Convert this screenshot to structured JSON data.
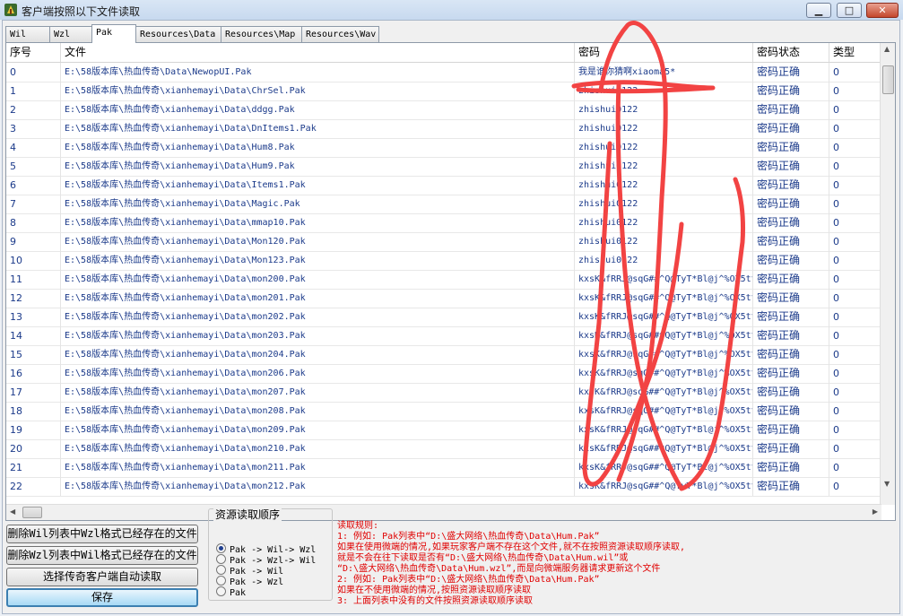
{
  "window": {
    "title": "客户端按照以下文件读取",
    "minimize": "▁",
    "maximize": "□",
    "close": "✕"
  },
  "tabs": [
    {
      "label": "Wil"
    },
    {
      "label": "Wzl"
    },
    {
      "label": "Pak"
    },
    {
      "label": "Resources\\Data"
    },
    {
      "label": "Resources\\Map"
    },
    {
      "label": "Resources\\Wav"
    }
  ],
  "columns": [
    "序号",
    "文件",
    "密码",
    "密码状态",
    "类型"
  ],
  "rows": [
    {
      "idx": "0",
      "file": "E:\\58版本库\\热血传奇\\Data\\NewopUI.Pak",
      "pw": "我是谁你猜啊xiaoma5*",
      "status": "密码正确",
      "type": "0"
    },
    {
      "idx": "1",
      "file": "E:\\58版本库\\热血传奇\\xianhemayi\\Data\\ChrSel.Pak",
      "pw": "zhishui0122",
      "status": "密码正确",
      "type": "0"
    },
    {
      "idx": "2",
      "file": "E:\\58版本库\\热血传奇\\xianhemayi\\Data\\ddgg.Pak",
      "pw": "zhishui0122",
      "status": "密码正确",
      "type": "0"
    },
    {
      "idx": "3",
      "file": "E:\\58版本库\\热血传奇\\xianhemayi\\Data\\DnItems1.Pak",
      "pw": "zhishui0122",
      "status": "密码正确",
      "type": "0"
    },
    {
      "idx": "4",
      "file": "E:\\58版本库\\热血传奇\\xianhemayi\\Data\\Hum8.Pak",
      "pw": "zhishui0122",
      "status": "密码正确",
      "type": "0"
    },
    {
      "idx": "5",
      "file": "E:\\58版本库\\热血传奇\\xianhemayi\\Data\\Hum9.Pak",
      "pw": "zhishui0122",
      "status": "密码正确",
      "type": "0"
    },
    {
      "idx": "6",
      "file": "E:\\58版本库\\热血传奇\\xianhemayi\\Data\\Items1.Pak",
      "pw": "zhishui0122",
      "status": "密码正确",
      "type": "0"
    },
    {
      "idx": "7",
      "file": "E:\\58版本库\\热血传奇\\xianhemayi\\Data\\Magic.Pak",
      "pw": "zhishui0122",
      "status": "密码正确",
      "type": "0"
    },
    {
      "idx": "8",
      "file": "E:\\58版本库\\热血传奇\\xianhemayi\\Data\\mmap10.Pak",
      "pw": "zhishui0122",
      "status": "密码正确",
      "type": "0"
    },
    {
      "idx": "9",
      "file": "E:\\58版本库\\热血传奇\\xianhemayi\\Data\\Mon120.Pak",
      "pw": "zhishui0122",
      "status": "密码正确",
      "type": "0"
    },
    {
      "idx": "10",
      "file": "E:\\58版本库\\热血传奇\\xianhemayi\\Data\\Mon123.Pak",
      "pw": "zhishui0122",
      "status": "密码正确",
      "type": "0"
    },
    {
      "idx": "11",
      "file": "E:\\58版本库\\热血传奇\\xianhemayi\\Data\\mon200.Pak",
      "pw": "kxsK&fRRJ@sqG##^Q@TyT*Bl@j^%OX5tt",
      "status": "密码正确",
      "type": "0"
    },
    {
      "idx": "12",
      "file": "E:\\58版本库\\热血传奇\\xianhemayi\\Data\\mon201.Pak",
      "pw": "kxsK&fRRJ@sqG##^Q@TyT*Bl@j^%OX5tt",
      "status": "密码正确",
      "type": "0"
    },
    {
      "idx": "13",
      "file": "E:\\58版本库\\热血传奇\\xianhemayi\\Data\\mon202.Pak",
      "pw": "kxsK&fRRJ@sqG##^Q@TyT*Bl@j^%OX5tt",
      "status": "密码正确",
      "type": "0"
    },
    {
      "idx": "14",
      "file": "E:\\58版本库\\热血传奇\\xianhemayi\\Data\\mon203.Pak",
      "pw": "kxsK&fRRJ@sqG##^Q@TyT*Bl@j^%OX5tt",
      "status": "密码正确",
      "type": "0"
    },
    {
      "idx": "15",
      "file": "E:\\58版本库\\热血传奇\\xianhemayi\\Data\\mon204.Pak",
      "pw": "kxsK&fRRJ@sqG##^Q@TyT*Bl@j^%OX5tt",
      "status": "密码正确",
      "type": "0"
    },
    {
      "idx": "16",
      "file": "E:\\58版本库\\热血传奇\\xianhemayi\\Data\\mon206.Pak",
      "pw": "kxsK&fRRJ@sqG##^Q@TyT*Bl@j^%OX5tt",
      "status": "密码正确",
      "type": "0"
    },
    {
      "idx": "17",
      "file": "E:\\58版本库\\热血传奇\\xianhemayi\\Data\\mon207.Pak",
      "pw": "kxsK&fRRJ@sqG##^Q@TyT*Bl@j^%OX5tt",
      "status": "密码正确",
      "type": "0"
    },
    {
      "idx": "18",
      "file": "E:\\58版本库\\热血传奇\\xianhemayi\\Data\\mon208.Pak",
      "pw": "kxsK&fRRJ@sqG##^Q@TyT*Bl@j^%OX5tt",
      "status": "密码正确",
      "type": "0"
    },
    {
      "idx": "19",
      "file": "E:\\58版本库\\热血传奇\\xianhemayi\\Data\\mon209.Pak",
      "pw": "kxsK&fRRJ@sqG##^Q@TyT*Bl@j^%OX5tt",
      "status": "密码正确",
      "type": "0"
    },
    {
      "idx": "20",
      "file": "E:\\58版本库\\热血传奇\\xianhemayi\\Data\\mon210.Pak",
      "pw": "kxsK&fRRJ@sqG##^Q@TyT*Bl@j^%OX5tt",
      "status": "密码正确",
      "type": "0"
    },
    {
      "idx": "21",
      "file": "E:\\58版本库\\热血传奇\\xianhemayi\\Data\\mon211.Pak",
      "pw": "kxsK&fRRJ@sqG##^Q@TyT*Bl@j^%OX5tt",
      "status": "密码正确",
      "type": "0"
    },
    {
      "idx": "22",
      "file": "E:\\58版本库\\热血传奇\\xianhemayi\\Data\\mon212.Pak",
      "pw": "kxsK&fRRJ@sqG##^Q@TyT*Bl@j^%OX5tt",
      "status": "密码正确",
      "type": "0"
    }
  ],
  "buttons": {
    "delete_wil": "删除Wil列表中Wzl格式已经存在的文件",
    "delete_wzl": "删除Wzl列表中Wil格式已经存在的文件",
    "select_client": "选择传奇客户端自动读取",
    "save": "保存"
  },
  "read_order": {
    "title": "资源读取顺序",
    "options": [
      {
        "label": "Pak -> Wil-> Wzl",
        "selected": true
      },
      {
        "label": "Pak -> Wzl-> Wil",
        "selected": false
      },
      {
        "label": "Pak -> Wil",
        "selected": false
      },
      {
        "label": "Pak -> Wzl",
        "selected": false
      },
      {
        "label": "Pak",
        "selected": false
      }
    ]
  },
  "rules": [
    "读取规则:",
    "1: 例如: Pak列表中“D:\\盛大网络\\热血传奇\\Data\\Hum.Pak”",
    "    如果在使用微端的情况,如果玩家客户端不存在这个文件,就不在按照资源读取顺序读取,",
    "    就是不会在往下读取是否有“D:\\盛大网络\\热血传奇\\Data\\Hum.wil”或",
    "    “D:\\盛大网络\\热血传奇\\Data\\Hum.wzl”,而是向微端服务器请求更新这个文件",
    "2: 例如: Pak列表中“D:\\盛大网络\\热血传奇\\Data\\Hum.Pak”",
    "    如果在不使用微端的情况,按照资源读取顺序读取",
    "3: 上面列表中没有的文件按照资源读取顺序读取"
  ],
  "colors": {
    "rule_text": "#e00000",
    "cell_text": "#1b3a8a",
    "scribble": "#f24343"
  }
}
